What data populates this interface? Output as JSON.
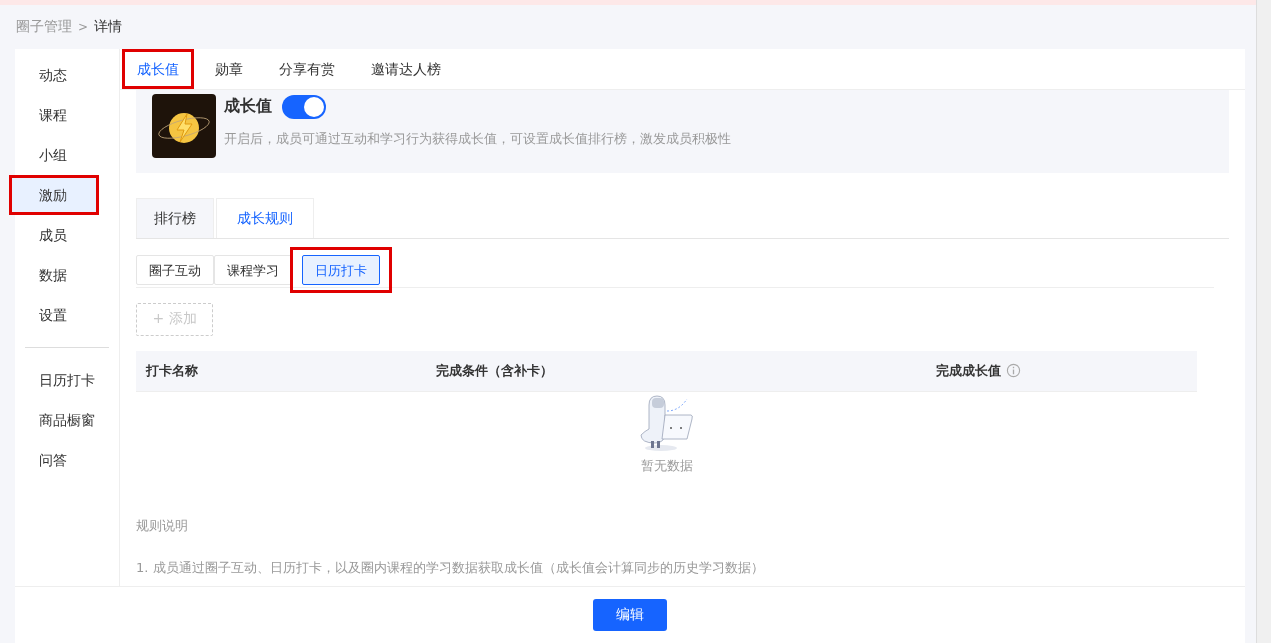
{
  "breadcrumb": {
    "parent": "圈子管理",
    "separator": ">",
    "current": "详情"
  },
  "sidebar": {
    "items": [
      {
        "label": "动态",
        "selected": false,
        "highlighted": false
      },
      {
        "label": "课程",
        "selected": false,
        "highlighted": false
      },
      {
        "label": "小组",
        "selected": false,
        "highlighted": false
      },
      {
        "label": "激励",
        "selected": true,
        "highlighted": true
      },
      {
        "label": "成员",
        "selected": false,
        "highlighted": false
      },
      {
        "label": "数据",
        "selected": false,
        "highlighted": false
      },
      {
        "label": "设置",
        "selected": false,
        "highlighted": false
      }
    ],
    "extra_items": [
      {
        "label": "日历打卡",
        "selected": false
      },
      {
        "label": "商品橱窗",
        "selected": false
      },
      {
        "label": "问答",
        "selected": false
      }
    ]
  },
  "top_tabs": [
    {
      "label": "成长值",
      "selected": true,
      "highlighted": true
    },
    {
      "label": "勋章",
      "selected": false,
      "highlighted": false
    },
    {
      "label": "分享有赏",
      "selected": false,
      "highlighted": false
    },
    {
      "label": "邀请达人榜",
      "selected": false,
      "highlighted": false
    }
  ],
  "feature": {
    "title": "成长值",
    "on": true,
    "description": "开启后，成员可通过互动和学习行为获得成长值，可设置成长值排行榜，激发成员积极性"
  },
  "tabs": [
    {
      "label": "排行榜",
      "selected": false
    },
    {
      "label": "成长规则",
      "selected": true
    }
  ],
  "sub_tabs": [
    {
      "label": "圈子互动",
      "selected": false,
      "highlighted": false
    },
    {
      "label": "课程学习",
      "selected": false,
      "highlighted": false
    },
    {
      "label": "日历打卡",
      "selected": true,
      "highlighted": true
    }
  ],
  "add_button": {
    "icon": "+",
    "label": "添加",
    "disabled": true
  },
  "table": {
    "columns": [
      "打卡名称",
      "完成条件（含补卡）",
      "完成成长值"
    ],
    "empty_text": "暂无数据"
  },
  "rules": {
    "title": "规则说明",
    "items": [
      "1. 成员通过圈子互动、日历打卡，以及圈内课程的学习数据获取成长值（成长值会计算同步的历史学习数据）"
    ]
  },
  "footer": {
    "button": "编辑"
  }
}
